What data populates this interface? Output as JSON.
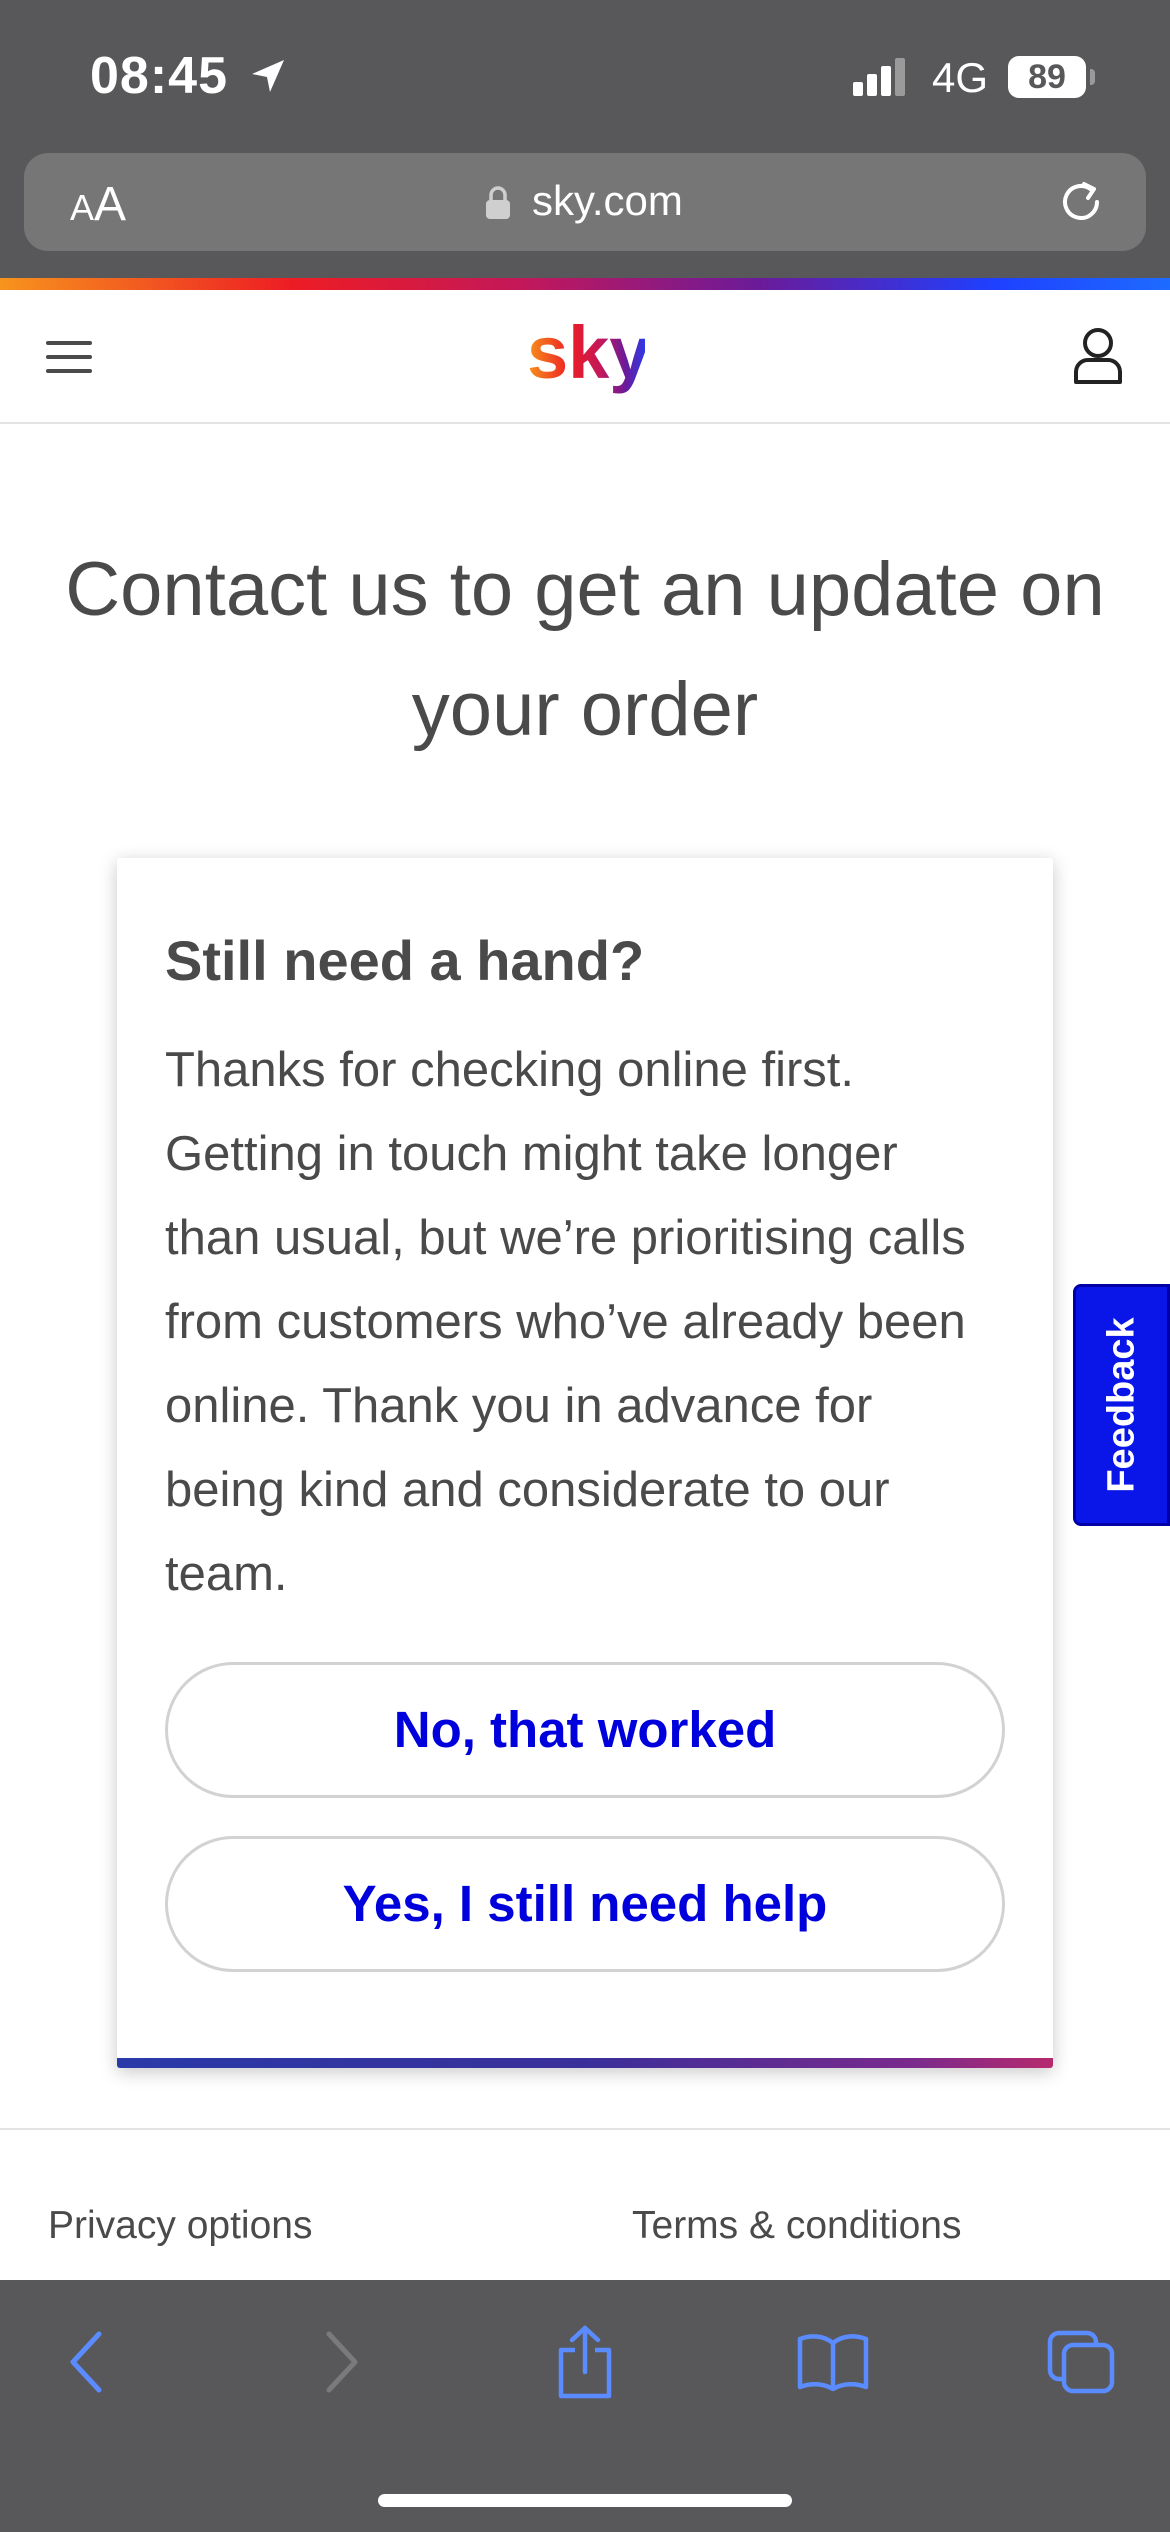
{
  "status_bar": {
    "time": "08:45",
    "network": "4G",
    "battery": "89",
    "location_icon": "location-arrow-icon",
    "signal_icon": "signal-bars-icon"
  },
  "browser": {
    "text_size_label_small": "A",
    "text_size_label_large": "A",
    "url": "sky.com",
    "lock_icon": "lock-icon",
    "reload_icon": "reload-icon"
  },
  "header": {
    "logo_text": "sky",
    "menu_icon": "hamburger-menu-icon",
    "account_icon": "account-person-icon",
    "brand_gradient": [
      "#f7941d",
      "#ed1c24",
      "#c2185b",
      "#6a1b9a",
      "#1e40ff"
    ]
  },
  "main": {
    "title": "Contact us to get an update on your order"
  },
  "help_card": {
    "title": "Still need a hand?",
    "body": "Thanks for checking online first. Getting in touch might take longer than usual, but we’re prioritising calls from customers who’ve already been online. Thank you in advance for being kind and considerate to our team.",
    "button_worked": "No, that worked",
    "button_help": "Yes, I still need help",
    "button_text_color": "#0000dc"
  },
  "feedback": {
    "label": "Feedback",
    "color": "#0a16e8"
  },
  "footer": {
    "privacy": "Privacy options",
    "terms": "Terms & conditions"
  },
  "toolbar": {
    "icons": [
      "back-chevron-icon",
      "forward-chevron-icon",
      "share-icon",
      "bookmarks-book-icon",
      "tabs-icon"
    ],
    "accent": "#5b8cff"
  }
}
